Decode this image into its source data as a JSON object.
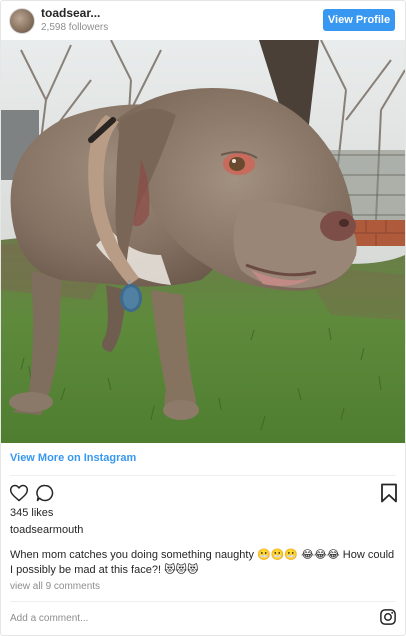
{
  "header": {
    "username": "toadsear...",
    "followers": "2,598 followers",
    "view_profile_label": "View Profile"
  },
  "photo": {
    "alt": "dog photo"
  },
  "links": {
    "view_more": "View More on Instagram"
  },
  "post": {
    "likes": "345 likes",
    "owner": "toadsearmouth",
    "caption": "When mom catches you doing something naughty 😬😬😬 😂😂😂 How could I possibly be mad at this face?! 😻😻😻",
    "view_comments": "view all 9 comments",
    "add_comment_placeholder": "Add a comment..."
  },
  "icons": {
    "like": "heart-icon",
    "comment": "comment-icon",
    "save": "bookmark-icon",
    "instagram": "instagram-logo-icon"
  },
  "colors": {
    "accent": "#3897f0",
    "text": "#262626",
    "muted": "#8e8e8e",
    "border": "#efefef"
  }
}
